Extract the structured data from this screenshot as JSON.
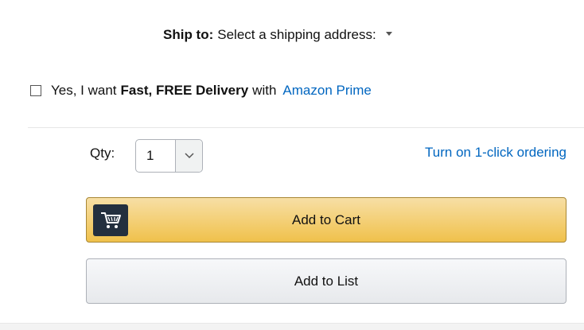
{
  "shipping": {
    "label": "Ship to:",
    "address": "Select a shipping address:"
  },
  "prime": {
    "checked": false,
    "text_before": "Yes, I want",
    "text_bold": "Fast, FREE Delivery",
    "text_after": "with",
    "link": "Amazon Prime"
  },
  "quantity": {
    "label": "Qty:",
    "value": "1"
  },
  "one_click": {
    "link": "Turn on 1-click ordering"
  },
  "buttons": {
    "add_to_cart": "Add to Cart",
    "add_to_list": "Add to List"
  },
  "icons": {
    "dropdown": "triangle-down-icon",
    "select_chevron": "chevron-down-icon",
    "cart": "cart-icon"
  },
  "colors": {
    "link": "#0066c0",
    "cart_button": "#f0c14b",
    "cart_icon_bg": "#232f3e",
    "list_button": "#e7e9ec"
  }
}
